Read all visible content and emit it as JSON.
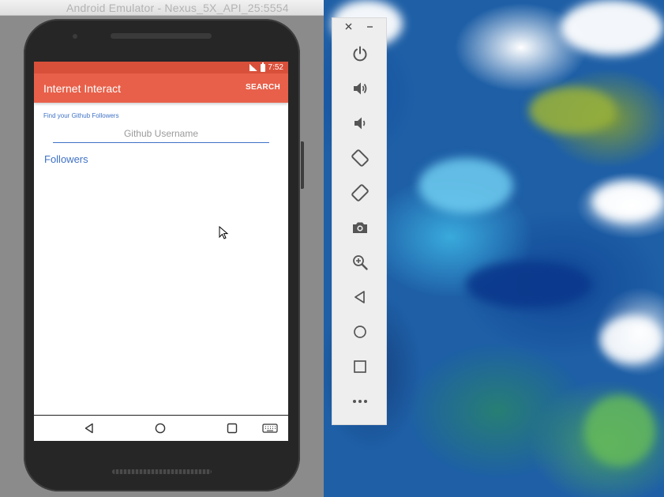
{
  "emulator": {
    "window_title": "Android Emulator - Nexus_5X_API_25:5554"
  },
  "status_bar": {
    "time": "7:52",
    "color": "#d9503a"
  },
  "app": {
    "title": "Internet Interact",
    "action_label": "SEARCH",
    "accent_color": "#e8604a",
    "find_label": "Find your Github Followers",
    "username_placeholder": "Github Username",
    "username_value": "",
    "followers_label": "Followers"
  },
  "nav_bar": {
    "icons": [
      "back-icon",
      "home-icon",
      "recents-icon",
      "keyboard-icon"
    ]
  },
  "toolbar": {
    "icons": [
      "close-icon",
      "minimize-icon",
      "power-icon",
      "volume-up-icon",
      "volume-down-icon",
      "rotate-left-icon",
      "rotate-right-icon",
      "camera-icon",
      "zoom-icon",
      "back-icon",
      "home-icon",
      "overview-icon",
      "more-icon"
    ]
  }
}
